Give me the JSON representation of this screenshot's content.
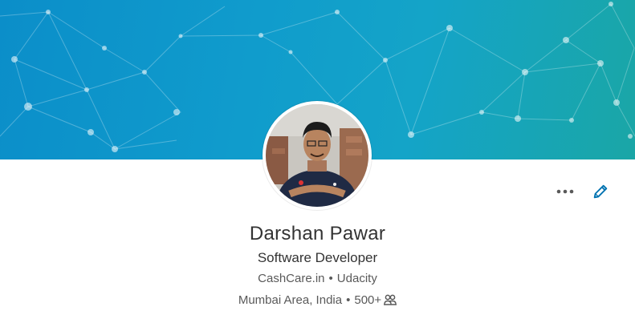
{
  "profile": {
    "name": "Darshan Pawar",
    "headline": "Software Developer",
    "companies": [
      "CashCare.in",
      "Udacity"
    ],
    "location": "Mumbai Area, India",
    "connections": "500+",
    "separator": "•"
  },
  "icons": {
    "more": "more-horizontal-icon",
    "edit": "pencil-icon",
    "connections": "people-icon"
  },
  "colors": {
    "banner_start": "#0b8ec9",
    "banner_end": "#1aa6a6",
    "accent": "#0073b1",
    "text_primary": "#333333",
    "text_secondary": "#595959"
  }
}
